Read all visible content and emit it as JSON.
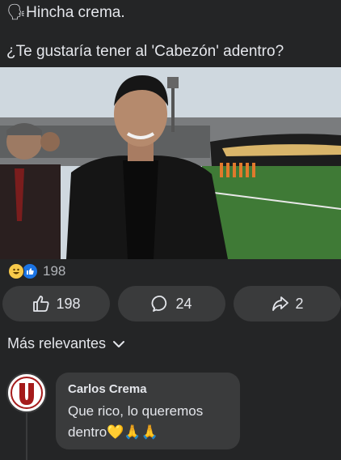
{
  "post": {
    "line1_emoji": "🗣",
    "line1": "Hincha crema.",
    "line2": "¿Te gustaría tener al 'Cabezón' adentro?"
  },
  "reactions": {
    "count": "198",
    "icons": [
      "haha-icon",
      "like-icon"
    ]
  },
  "actions": {
    "like_count": "198",
    "comment_count": "24",
    "share_count": "2"
  },
  "comments_sort": {
    "label": "Más relevantes"
  },
  "comment": {
    "author": "Carlos Crema",
    "text": "Que rico, lo queremos dentro💛🙏🙏"
  },
  "colors": {
    "background": "#242526",
    "bubble": "#3a3b3c",
    "text": "#e4e6eb",
    "like_blue": "#1b74e4",
    "club_red": "#a51b1b"
  }
}
